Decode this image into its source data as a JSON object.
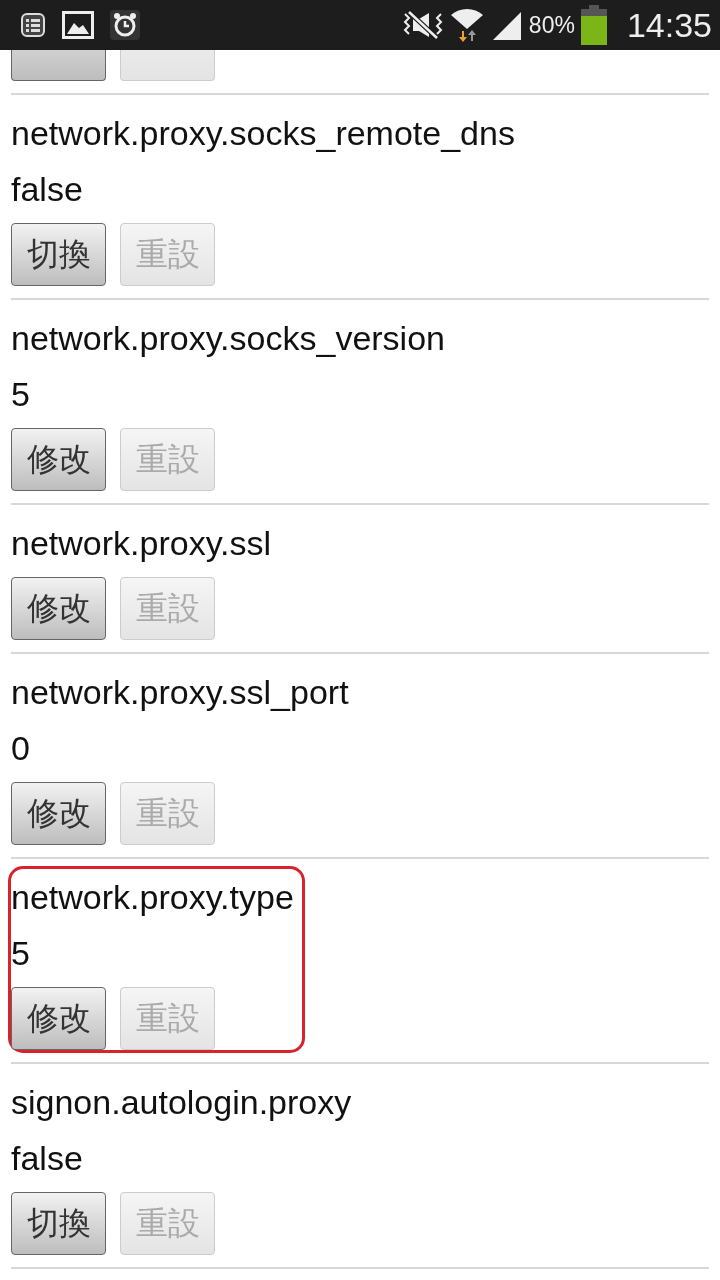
{
  "status_bar": {
    "battery": "80%",
    "time": "14:35"
  },
  "entries": [
    {
      "buttons": [
        {
          "disabled": false
        },
        {
          "disabled": true
        }
      ]
    },
    {
      "name": "network.proxy.socks_remote_dns",
      "value": "false",
      "highlighted": false,
      "buttons": [
        {
          "label": "切換",
          "disabled": false
        },
        {
          "label": "重設",
          "disabled": true
        }
      ]
    },
    {
      "name": "network.proxy.socks_version",
      "value": "5",
      "highlighted": false,
      "buttons": [
        {
          "label": "修改",
          "disabled": false
        },
        {
          "label": "重設",
          "disabled": true
        }
      ]
    },
    {
      "name": "network.proxy.ssl",
      "highlighted": false,
      "buttons": [
        {
          "label": "修改",
          "disabled": false
        },
        {
          "label": "重設",
          "disabled": true
        }
      ]
    },
    {
      "name": "network.proxy.ssl_port",
      "value": "0",
      "highlighted": false,
      "buttons": [
        {
          "label": "修改",
          "disabled": false
        },
        {
          "label": "重設",
          "disabled": true
        }
      ]
    },
    {
      "name": "network.proxy.type",
      "value": "5",
      "highlighted": true,
      "buttons": [
        {
          "label": "修改",
          "disabled": false
        },
        {
          "label": "重設",
          "disabled": true
        }
      ]
    },
    {
      "name": "signon.autologin.proxy",
      "value": "false",
      "highlighted": false,
      "buttons": [
        {
          "label": "切換",
          "disabled": false
        },
        {
          "label": "重設",
          "disabled": true
        }
      ]
    }
  ]
}
